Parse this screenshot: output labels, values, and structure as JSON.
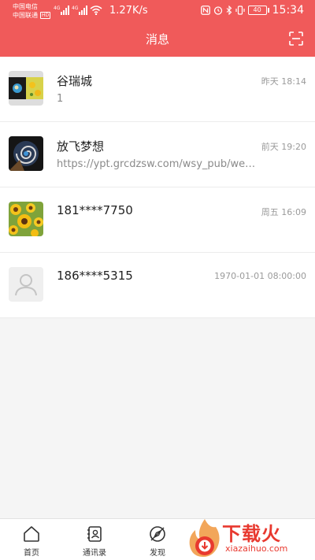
{
  "status_bar": {
    "carrier_1": "中国电信",
    "carrier_2": "中国联通",
    "hd": "HD",
    "net_1": "4G",
    "net_2": "4G",
    "speed": "1.27K/s",
    "battery": "40",
    "time": "15:34"
  },
  "header": {
    "title": "消息",
    "scan_icon": "scan-icon"
  },
  "messages": [
    {
      "name": "谷瑞城",
      "preview": "1",
      "time": "昨天 18:14",
      "avatar": "split-photo"
    },
    {
      "name": "放飞梦想",
      "preview": "https://ypt.grcdzsw.com/wsy_pub/web...",
      "time": "前天 19:20",
      "avatar": "spiral-photo"
    },
    {
      "name": "181****7750",
      "preview": "",
      "time": "周五 16:09",
      "avatar": "sunflower-photo"
    },
    {
      "name": "186****5315",
      "preview": "",
      "time": "1970-01-01 08:00:00",
      "avatar": "default-user"
    }
  ],
  "bottom_nav": [
    {
      "label": "首页",
      "icon": "home-icon"
    },
    {
      "label": "通讯录",
      "icon": "contacts-icon"
    },
    {
      "label": "发现",
      "icon": "compass-icon"
    }
  ],
  "watermark": {
    "logo_text": "下载火",
    "url": "xiazaihuo.com"
  },
  "colors": {
    "accent": "#f05a5a",
    "watermark": "#e8392f"
  }
}
